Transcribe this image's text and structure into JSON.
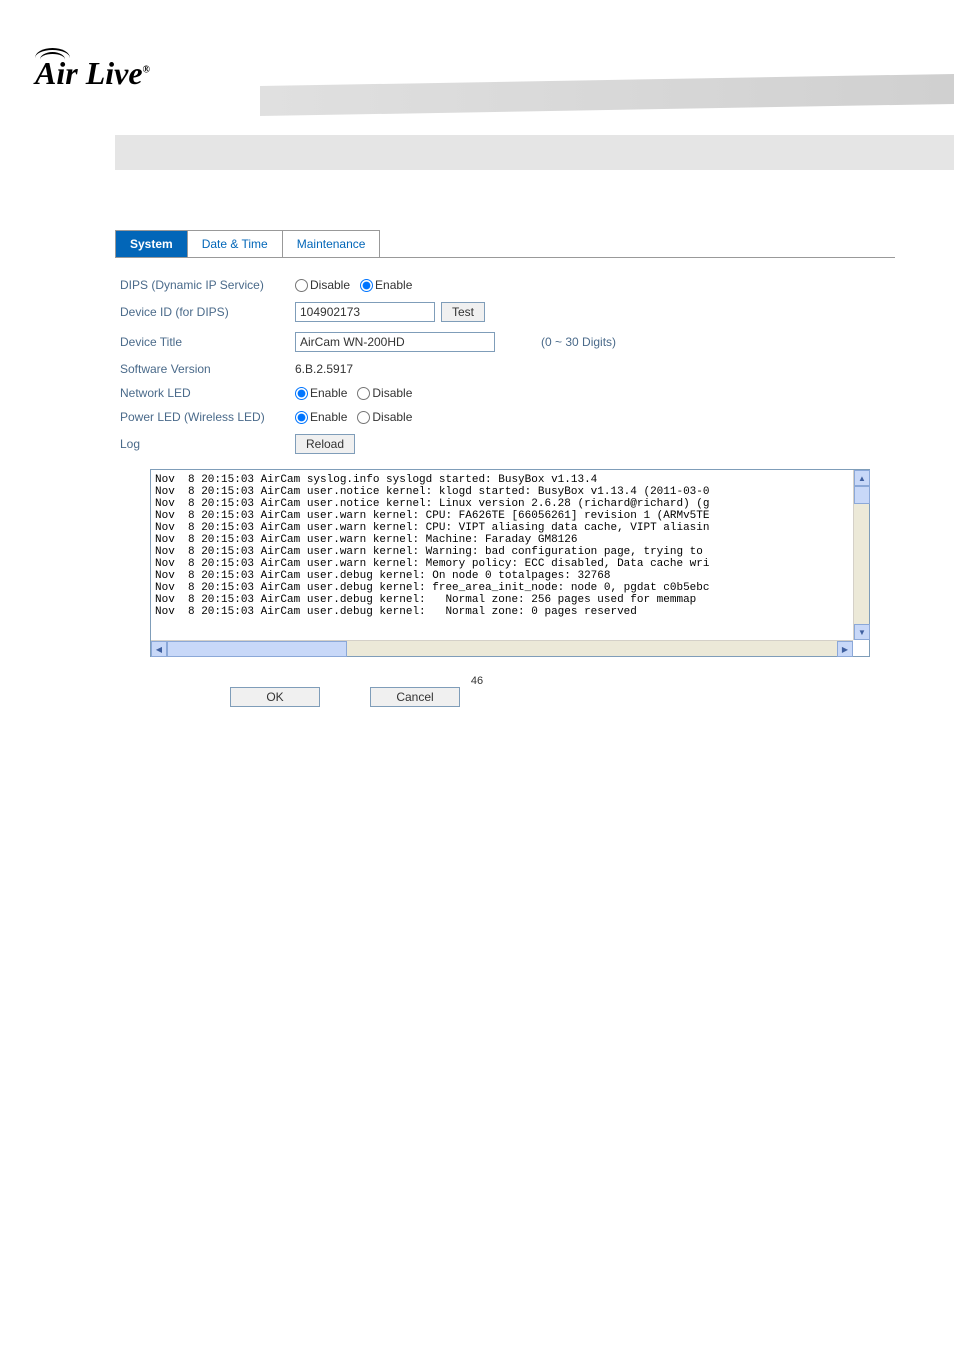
{
  "logo": {
    "text": "Air Live",
    "reg": "®"
  },
  "tabs": {
    "system": "System",
    "date_time": "Date & Time",
    "maintenance": "Maintenance"
  },
  "form": {
    "dips_label": "DIPS (Dynamic IP Service)",
    "dips_disable": "Disable",
    "dips_enable": "Enable",
    "device_id_label": "Device ID (for DIPS)",
    "device_id_value": "104902173",
    "test_btn": "Test",
    "device_title_label": "Device Title",
    "device_title_value": "AirCam WN-200HD",
    "digits_hint": "(0 ~ 30 Digits)",
    "software_version_label": "Software Version",
    "software_version_value": "6.B.2.5917",
    "network_led_label": "Network LED",
    "power_led_label": "Power LED (Wireless LED)",
    "enable": "Enable",
    "disable": "Disable",
    "log_label": "Log",
    "reload_btn": "Reload"
  },
  "log_lines": [
    "Nov  8 20:15:03 AirCam syslog.info syslogd started: BusyBox v1.13.4",
    "Nov  8 20:15:03 AirCam user.notice kernel: klogd started: BusyBox v1.13.4 (2011-03-0",
    "Nov  8 20:15:03 AirCam user.notice kernel: Linux version 2.6.28 (richard@richard) (g",
    "Nov  8 20:15:03 AirCam user.warn kernel: CPU: FA626TE [66056261] revision 1 (ARMv5TE",
    "Nov  8 20:15:03 AirCam user.warn kernel: CPU: VIPT aliasing data cache, VIPT aliasin",
    "Nov  8 20:15:03 AirCam user.warn kernel: Machine: Faraday GM8126",
    "Nov  8 20:15:03 AirCam user.warn kernel: Warning: bad configuration page, trying to",
    "Nov  8 20:15:03 AirCam user.warn kernel: Memory policy: ECC disabled, Data cache wri",
    "Nov  8 20:15:03 AirCam user.debug kernel: On node 0 totalpages: 32768",
    "Nov  8 20:15:03 AirCam user.debug kernel: free_area_init_node: node 0, pgdat c0b5ebc",
    "Nov  8 20:15:03 AirCam user.debug kernel:   Normal zone: 256 pages used for memmap",
    "Nov  8 20:15:03 AirCam user.debug kernel:   Normal zone: 0 pages reserved"
  ],
  "buttons": {
    "ok": "OK",
    "cancel": "Cancel"
  },
  "page_number": "46"
}
